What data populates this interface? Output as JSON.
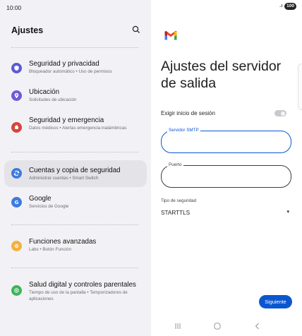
{
  "status": {
    "time": "10:00",
    "signal": "..ıl",
    "battery": "100"
  },
  "settings": {
    "title": "Ajustes",
    "groups": [
      [
        {
          "title": "Seguridad y privacidad",
          "subtitle": "Bloqueador automático • Uso de permisos",
          "icon": "shield-icon",
          "color": "#5b5bd6"
        },
        {
          "title": "Ubicación",
          "subtitle": "Solicitudes de ubicación",
          "icon": "location-pin-icon",
          "color": "#6f5ad8"
        },
        {
          "title": "Seguridad y emergencia",
          "subtitle": "Datos médicos • Alertas emergencia inalámbricas",
          "icon": "emergency-icon",
          "color": "#d6453b"
        }
      ],
      [
        {
          "title": "Cuentas y copia de seguridad",
          "subtitle": "Administrar cuentas • Smart Switch",
          "icon": "sync-icon",
          "color": "#3d7be0"
        },
        {
          "title": "Google",
          "subtitle": "Servicios de Google",
          "icon": "google-icon",
          "color": "#3d7be0"
        }
      ],
      [
        {
          "title": "Funciones avanzadas",
          "subtitle": "Labs • Botón Función",
          "icon": "advanced-features-icon",
          "color": "#f3b13c"
        }
      ],
      [
        {
          "title": "Salud digital y controles parentales",
          "subtitle": "Tiempo de uso de la pantalla • Temporizadores de aplicaciones",
          "icon": "digital-wellbeing-icon",
          "color": "#3cb55a"
        }
      ]
    ]
  },
  "gmail": {
    "heading": "Ajustes del servidor de salida",
    "require_signin_label": "Exigir inicio de sesión",
    "require_signin_on": false,
    "smtp_label": "Servidor SMTP",
    "smtp_value": "",
    "port_label": "Puerto",
    "port_value": "",
    "security_label": "Tipo de seguridad",
    "security_value": "STARTTLS",
    "next_label": "Siguiente"
  },
  "colors": {
    "accent": "#0b57d0",
    "settings_bg": "#f2f2f6",
    "active_item_bg": "#e3e3e8"
  }
}
